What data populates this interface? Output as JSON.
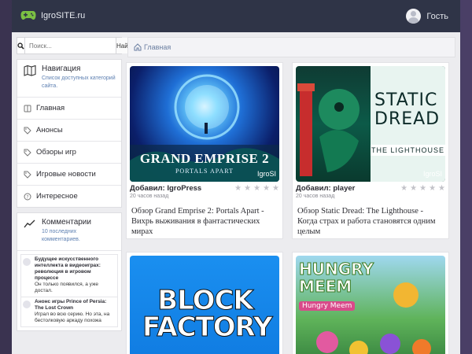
{
  "header": {
    "site_name": "IgroSITE.ru",
    "user_label": "Гость",
    "logo_icon": "gamepad-icon"
  },
  "search": {
    "placeholder": "Поиск...",
    "button_label": "Найти"
  },
  "navigation": {
    "title": "Навигация",
    "subtitle": "Список доступных категорий сайта.",
    "items": [
      {
        "label": "Главная",
        "icon": "book-icon"
      },
      {
        "label": "Анонсы",
        "icon": "tag-icon"
      },
      {
        "label": "Обзоры игр",
        "icon": "tag-icon"
      },
      {
        "label": "Игровые новости",
        "icon": "tag-icon"
      },
      {
        "label": "Интересное",
        "icon": "question-icon"
      }
    ]
  },
  "comments_box": {
    "title": "Комментарии",
    "subtitle": "10 последних комментариев.",
    "items": [
      {
        "title": "Будущее искусственного интеллекта в видеоиграх: революция в игровом процессе",
        "text": "Он только появился, а уже достал."
      },
      {
        "title": "Анонс игры Prince of Persia: The Lost Crown",
        "text": "Играл во всю серию. Но эта, на бестолковую аркаду похожа"
      }
    ]
  },
  "breadcrumb": {
    "home": "Главная"
  },
  "posts": [
    {
      "added_label": "Добавил:",
      "author": "IgroPress",
      "time": "20 часов назад",
      "title": "Обзор Grand Emprise 2: Portals Apart - Вихрь выживания в фантастических мирах",
      "image_text": "GRAND EMPRISE 2",
      "image_sub": "PORTALS APART",
      "watermark": "IgroSI"
    },
    {
      "added_label": "Добавил:",
      "author": "player",
      "time": "20 часов назад",
      "title": "Обзор Static Dread: The Lighthouse - Когда страх и работа становятся одним целым",
      "image_text": "STATIC DREAD",
      "image_sub": "THE LIGHTHOUSE",
      "watermark": "IgroSI"
    },
    {
      "image_text": "BLOCK FACTORY"
    },
    {
      "image_text": "HUNGRY MEEM",
      "image_sub": "Hungry Meem"
    }
  ],
  "colors": {
    "topbar": "#2f3447",
    "link": "#5e80b2",
    "star": "#c3c3c9"
  }
}
